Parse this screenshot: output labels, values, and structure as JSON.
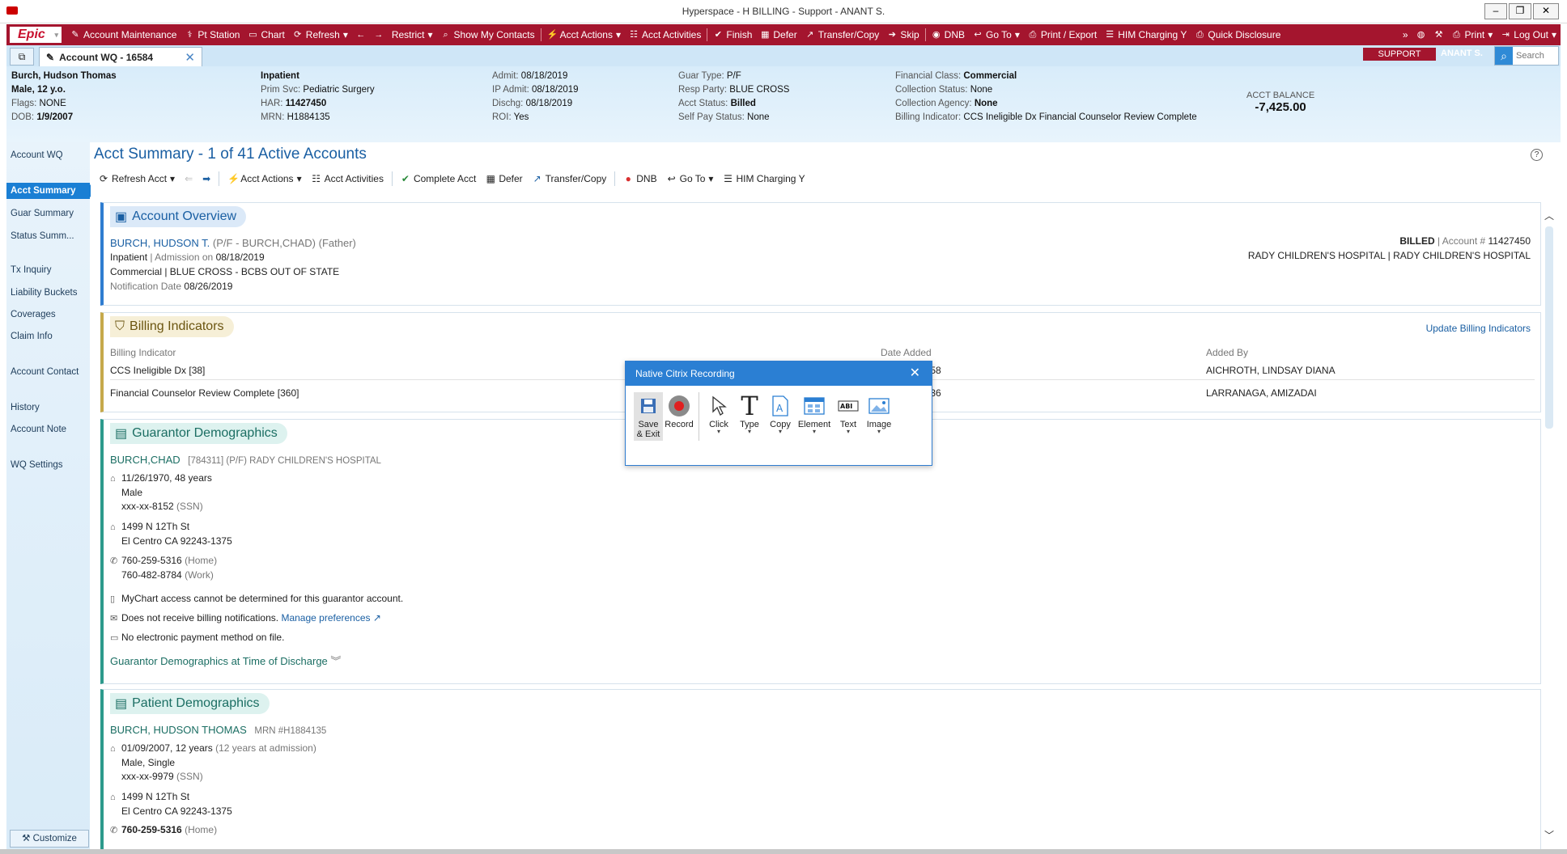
{
  "window": {
    "title": "Hyperspace - H BILLING - Support - ANANT S."
  },
  "epic_logo": "Epic",
  "main_toolbar": [
    {
      "label": "Account Maintenance",
      "icon": "edit-icon"
    },
    {
      "label": "Pt Station",
      "icon": "pt-station-icon"
    },
    {
      "label": "Chart",
      "icon": "folder-icon"
    },
    {
      "label": "Refresh",
      "icon": "refresh-icon",
      "dropdown": true
    },
    {
      "label": "",
      "icon": "back-arrow-icon"
    },
    {
      "label": "",
      "icon": "forward-arrow-icon"
    },
    {
      "label": "Restrict",
      "icon": "",
      "dropdown": true
    },
    {
      "label": "Show My Contacts",
      "icon": "search-icon"
    },
    {
      "label": "Acct Actions",
      "icon": "lightning-icon",
      "dropdown": true
    },
    {
      "label": "Acct Activities",
      "icon": "activities-icon"
    },
    {
      "label": "Finish",
      "icon": "checkmark-icon"
    },
    {
      "label": "Defer",
      "icon": "calendar-icon"
    },
    {
      "label": "Transfer/Copy",
      "icon": "transfer-icon"
    },
    {
      "label": "Skip",
      "icon": "skip-arrow-icon"
    },
    {
      "label": "DNB",
      "icon": "dnb-circle-icon"
    },
    {
      "label": "Go To",
      "icon": "goto-arrow-icon",
      "dropdown": true
    },
    {
      "label": "Print / Export",
      "icon": "printer-icon"
    },
    {
      "label": "HIM Charging Y",
      "icon": "list-icon"
    },
    {
      "label": "Quick Disclosure",
      "icon": "disclosure-icon"
    }
  ],
  "toolbar_right": {
    "print": "Print",
    "logout": "Log Out"
  },
  "tab": {
    "label": "Account WQ - 16584"
  },
  "support_badge": "SUPPORT",
  "user_badge": "ANANT S.",
  "search": {
    "placeholder": "Search"
  },
  "header": {
    "patient_name": "Burch, Hudson Thomas",
    "patient_sex_age": "Male, 12 y.o.",
    "flags_label": "Flags:",
    "flags": "NONE",
    "dob_label": "DOB:",
    "dob": "1/9/2007",
    "class": "Inpatient",
    "prim_svc_label": "Prim Svc:",
    "prim_svc": "Pediatric Surgery",
    "har_label": "HAR:",
    "har": "11427450",
    "mrn_label": "MRN:",
    "mrn": "H1884135",
    "admit_label": "Admit:",
    "admit": "08/18/2019",
    "ip_admit_label": "IP Admit:",
    "ip_admit": "08/18/2019",
    "dischg_label": "Dischg:",
    "dischg": "08/18/2019",
    "roi_label": "ROI:",
    "roi": "Yes",
    "guar_type_label": "Guar Type:",
    "guar_type": "P/F",
    "resp_party_label": "Resp Party:",
    "resp_party": "BLUE CROSS",
    "acct_status_label": "Acct Status:",
    "acct_status": "Billed",
    "self_pay_label": "Self Pay Status:",
    "self_pay": "None",
    "fin_class_label": "Financial Class:",
    "fin_class": "Commercial",
    "coll_status_label": "Collection Status:",
    "coll_status": "None",
    "coll_agency_label": "Collection Agency:",
    "coll_agency": "None",
    "billing_ind_label": "Billing Indicator:",
    "billing_ind": "CCS Ineligible Dx Financial Counselor Review Complete",
    "acct_balance_label": "ACCT BALANCE",
    "acct_balance": "-7,425.00"
  },
  "sidebar": [
    {
      "label": "Account WQ",
      "top": 0
    },
    {
      "label": "Acct Summary",
      "active": true
    },
    {
      "label": "Guar Summary"
    },
    {
      "label": "Status Summ..."
    },
    {
      "label": "Tx Inquiry"
    },
    {
      "label": "Liability Buckets"
    },
    {
      "label": "Coverages"
    },
    {
      "label": "Claim Info"
    },
    {
      "label": "Account Contact"
    },
    {
      "label": "History"
    },
    {
      "label": "Account Note"
    },
    {
      "label": "WQ Settings"
    }
  ],
  "customize_label": "Customize",
  "page_title": "Acct Summary - 1 of 41 Active Accounts",
  "action_bar": {
    "refresh": "Refresh Acct",
    "acct_actions": "Acct Actions",
    "acct_activities": "Acct Activities",
    "complete": "Complete Acct",
    "defer": "Defer",
    "transfer": "Transfer/Copy",
    "dnb": "DNB",
    "goto": "Go To",
    "him": "HIM Charging Y"
  },
  "overview": {
    "title": "Account Overview",
    "name": "BURCH, HUDSON T.",
    "guar": "(P/F - BURCH,CHAD) (Father)",
    "class": "Inpatient",
    "admission_label": "| Admission on",
    "admission_date": "08/18/2019",
    "coverage": "Commercial | BLUE CROSS - BCBS OUT OF STATE",
    "notification_label": "Notification Date",
    "notification_date": "08/26/2019",
    "status": "BILLED",
    "account_label": "| Account #",
    "account_no": "11427450",
    "hospital": "RADY CHILDREN'S HOSPITAL | RADY CHILDREN'S HOSPITAL"
  },
  "billing_indicators": {
    "title": "Billing Indicators",
    "update_link": "Update Billing Indicators",
    "col_indicator": "Billing Indicator",
    "col_date": "Date Added",
    "col_by": "Added By",
    "rows": [
      {
        "indicator": "CCS Ineligible Dx [38]",
        "date": "1058",
        "by": "AICHROTH, LINDSAY DIANA"
      },
      {
        "indicator": "Financial Counselor Review Complete [360]",
        "date": "0736",
        "by": "LARRANAGA, AMIZADAI"
      }
    ]
  },
  "guarantor": {
    "title": "Guarantor Demographics",
    "name": "BURCH,CHAD",
    "detail": "[784311] (P/F) RADY CHILDREN'S HOSPITAL",
    "dob": "11/26/1970, 48 years",
    "sex": "Male",
    "ssn": "xxx-xx-8152",
    "ssn_label": "(SSN)",
    "addr1": "1499 N 12Th St",
    "addr2": "El Centro CA 92243-1375",
    "phone_home": "760-259-5316",
    "phone_home_label": "(Home)",
    "phone_work": "760-482-8784",
    "phone_work_label": "(Work)",
    "mychart": "MyChart access cannot be determined for this guarantor account.",
    "notifications": "Does not receive billing notifications.",
    "manage_link": "Manage preferences",
    "payment": "No electronic payment method on file.",
    "discharge_link": "Guarantor Demographics at Time of Discharge"
  },
  "patient": {
    "title": "Patient Demographics",
    "name": "BURCH, HUDSON THOMAS",
    "mrn": "MRN #H1884135",
    "dob": "01/09/2007, 12 years",
    "dob_note": "(12 years at admission)",
    "sex": "Male, Single",
    "ssn": "xxx-xx-9979",
    "ssn_label": "(SSN)",
    "addr1": "1499 N 12Th St",
    "addr2": "El Centro CA 92243-1375",
    "phone_home": "760-259-5316",
    "phone_home_label": "(Home)"
  },
  "dialog": {
    "title": "Native Citrix Recording",
    "tools": [
      "Save & Exit",
      "Record",
      "Click",
      "Type",
      "Copy",
      "Element",
      "Text",
      "Image"
    ],
    "save_line1": "Save",
    "save_line2": "& Exit"
  }
}
